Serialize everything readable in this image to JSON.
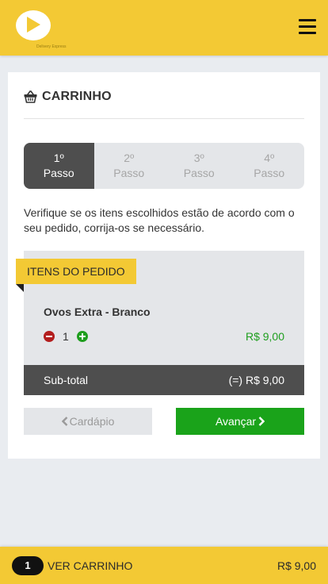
{
  "header": {
    "logo_caption": "Delivery Express",
    "menu_icon": "hamburger-menu-icon"
  },
  "cart": {
    "icon": "basket-icon",
    "title": "CARRINHO"
  },
  "steps": [
    {
      "number": "1º",
      "label": "Passo",
      "active": true
    },
    {
      "number": "2º",
      "label": "Passo",
      "active": false
    },
    {
      "number": "3º",
      "label": "Passo",
      "active": false
    },
    {
      "number": "4º",
      "label": "Passo",
      "active": false
    }
  ],
  "instructions": "Verifique se os itens escolhidos estão de acordo com o seu pedido, corrija-os se necessário.",
  "order": {
    "section_label": "ITENS DO PEDIDO",
    "items": [
      {
        "name": "Ovos Extra - Branco",
        "quantity": "1",
        "price": "R$ 9,00"
      }
    ],
    "subtotal_label": "Sub-total",
    "subtotal_value": "(=) R$ 9,00"
  },
  "actions": {
    "back_label": "Cardápio",
    "next_label": "Avançar"
  },
  "bottom_bar": {
    "count": "1",
    "label": "VER CARRINHO",
    "total": "R$ 9,00"
  },
  "colors": {
    "brand_yellow": "#f3c934",
    "dark": "#4e4e4e",
    "success_green": "#1aa31a",
    "danger_red": "#b31e1e"
  }
}
